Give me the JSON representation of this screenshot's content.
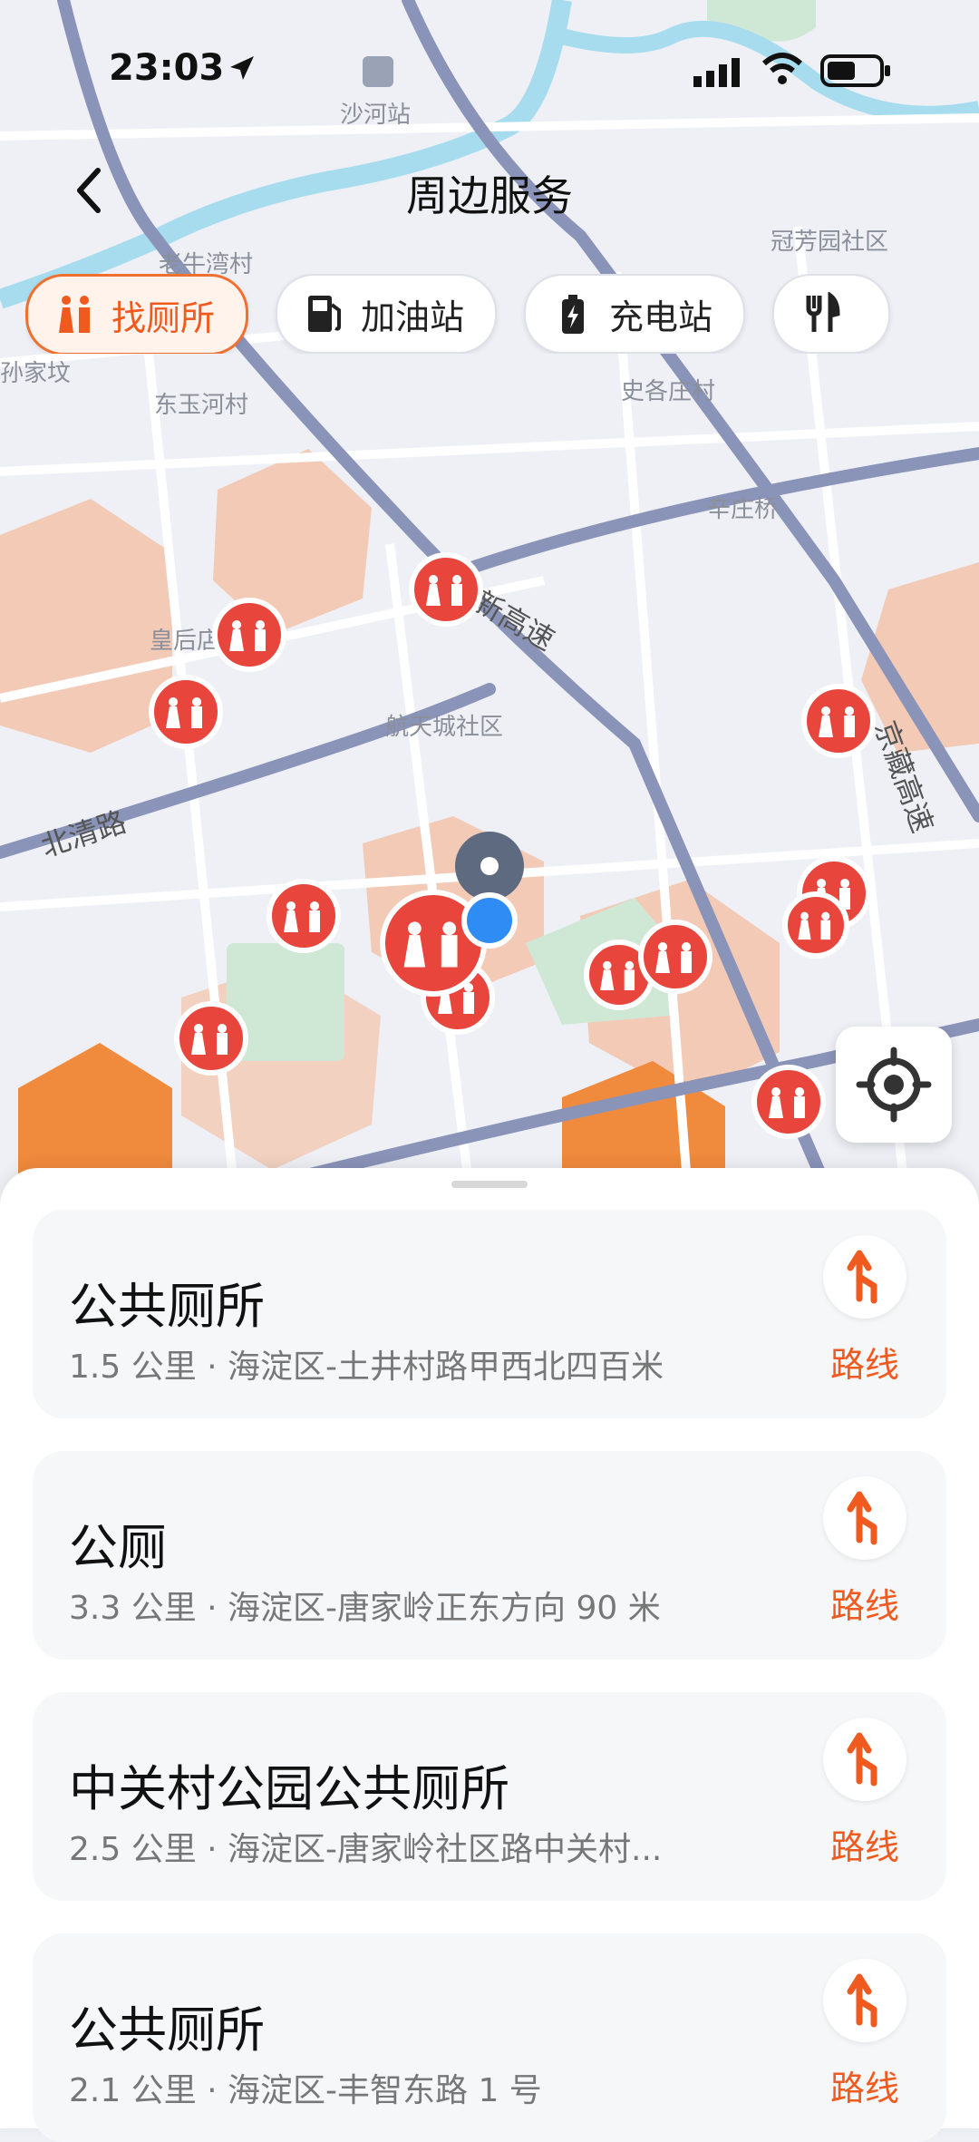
{
  "status_bar": {
    "time": "23:03"
  },
  "header": {
    "title": "周边服务"
  },
  "filters": [
    {
      "label": "找厕所",
      "icon": "restroom-icon",
      "active": true
    },
    {
      "label": "加油站",
      "icon": "gas-pump-icon",
      "active": false
    },
    {
      "label": "充电站",
      "icon": "battery-charging-icon",
      "active": false
    },
    {
      "label": "",
      "icon": "utensils-icon",
      "active": false
    }
  ],
  "map": {
    "labels": [
      "沙河站",
      "老牛湾村",
      "冠芳园社区",
      "孙家坟",
      "东玉河村",
      "史各庄村",
      "辛庄桥",
      "新高速",
      "皇后店",
      "航天城社区",
      "京藏高速",
      "北清路"
    ]
  },
  "results": [
    {
      "title": "公共厕所",
      "subtitle": "1.5 公里 · 海淀区-土井村路甲西北四百米",
      "route_label": "路线"
    },
    {
      "title": "公厕",
      "subtitle": "3.3 公里 · 海淀区-唐家岭正东方向 90 米",
      "route_label": "路线"
    },
    {
      "title": "中关村公园公共厕所",
      "subtitle": "2.5 公里 · 海淀区-唐家岭社区路中关村...",
      "route_label": "路线"
    },
    {
      "title": "公共厕所",
      "subtitle": "2.1 公里 · 海淀区-丰智东路 1 号",
      "route_label": "路线"
    }
  ],
  "colors": {
    "accent": "#f05a1e",
    "marker": "#e8453c",
    "highway": "#8a93b8",
    "water": "#a7dcef",
    "zone": "#f3c3aa",
    "zone_strong": "#f08a3c",
    "park": "#cfe8d6"
  }
}
